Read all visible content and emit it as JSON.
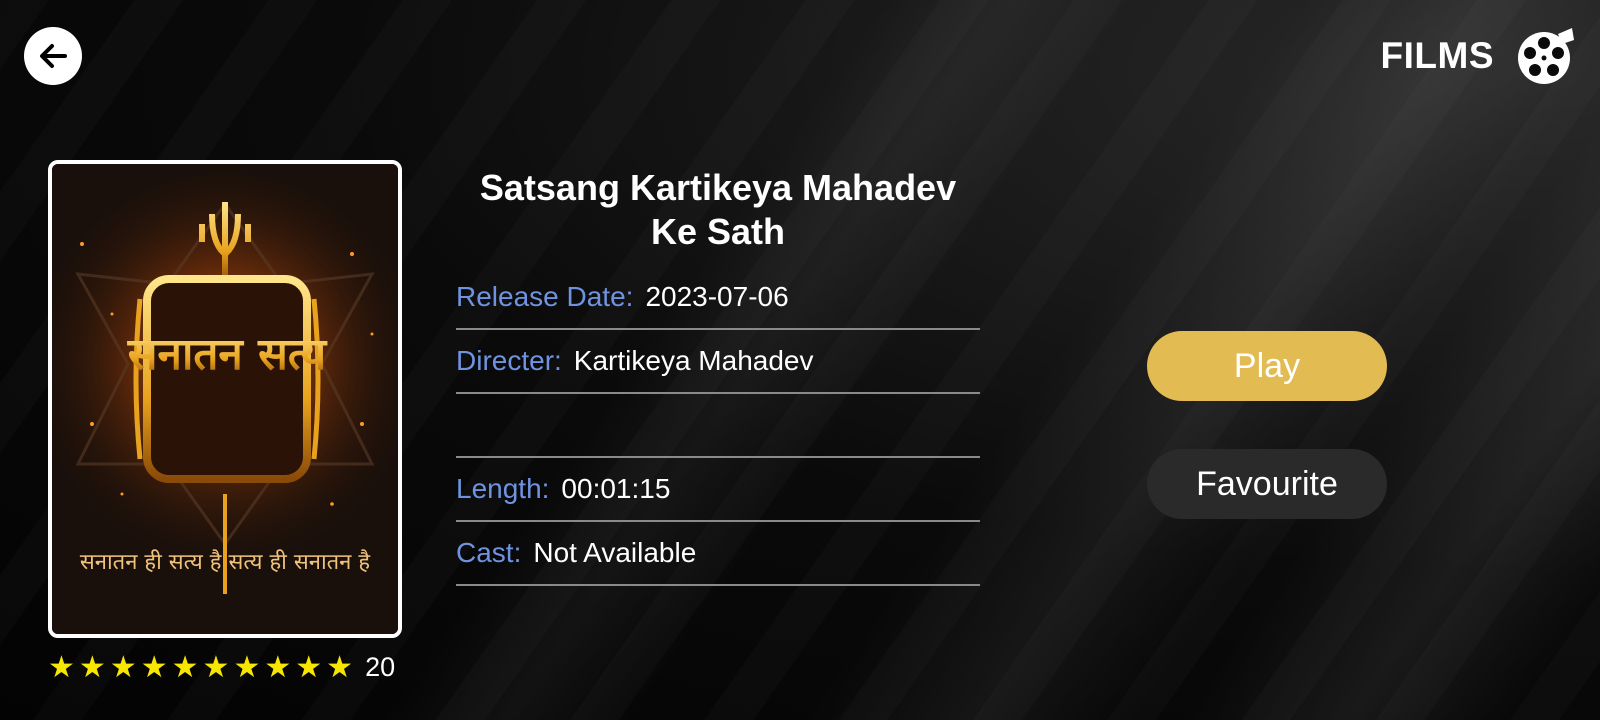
{
  "header": {
    "title": "FILMS",
    "back_icon": "arrow-left-icon",
    "section_icon": "film-reel-icon"
  },
  "poster": {
    "title_text": "सनातन सत्य",
    "tagline": "सनातन ही सत्य है सत्य ही सनातन है"
  },
  "rating": {
    "stars": 10,
    "count": "20",
    "star_color": "#f7e600"
  },
  "movie": {
    "title_line1": "Satsang Kartikeya Mahadev",
    "title_line2": "Ke Sath",
    "release_label": "Release Date:",
    "release_value": "2023-07-06",
    "director_label": "Directer:",
    "director_value": "Kartikeya Mahadev",
    "length_label": "Length:",
    "length_value": "00:01:15",
    "cast_label": "Cast:",
    "cast_value": "Not Available"
  },
  "actions": {
    "play_label": "Play",
    "favourite_label": "Favourite"
  },
  "colors": {
    "accent": "#e2bb52",
    "label": "#6f93e0",
    "secondary_button": "#2a2a2a"
  }
}
